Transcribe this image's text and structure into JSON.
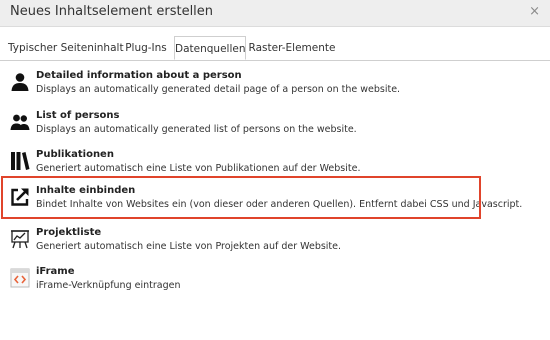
{
  "dialog": {
    "title": "Neues Inhaltselement erstellen",
    "close_glyph": "×"
  },
  "tabs": [
    {
      "label": "Typischer Seiteninhalt",
      "active": false
    },
    {
      "label": "Plug-Ins",
      "active": false
    },
    {
      "label": "Datenquellen",
      "active": true
    },
    {
      "label": "Raster-Elemente",
      "active": false
    }
  ],
  "items": [
    {
      "icon": "person-icon",
      "label": "Detailed information about a person",
      "description": "Displays an automatically generated detail page of a person on the website."
    },
    {
      "icon": "persons-icon",
      "label": "List of persons",
      "description": "Displays an automatically generated list of persons on the website."
    },
    {
      "icon": "books-icon",
      "label": "Publikationen",
      "description": "Generiert automatisch eine Liste von Publikationen auf der Website."
    },
    {
      "icon": "external-link-icon",
      "label": "Inhalte einbinden",
      "description": "Bindet Inhalte von Websites ein (von dieser oder anderen Quellen). Entfernt dabei CSS und Javascript.",
      "highlighted": true
    },
    {
      "icon": "presentation-board-icon",
      "label": "Projektliste",
      "description": "Generiert automatisch eine Liste von Projekten auf der Website."
    },
    {
      "icon": "iframe-icon",
      "label": "iFrame",
      "description": "iFrame-Verknüpfung eintragen"
    }
  ],
  "colors": {
    "highlight_border": "#e0442b",
    "header_bg": "#eeeeee",
    "iframe_icon_accent": "#e8633a"
  }
}
